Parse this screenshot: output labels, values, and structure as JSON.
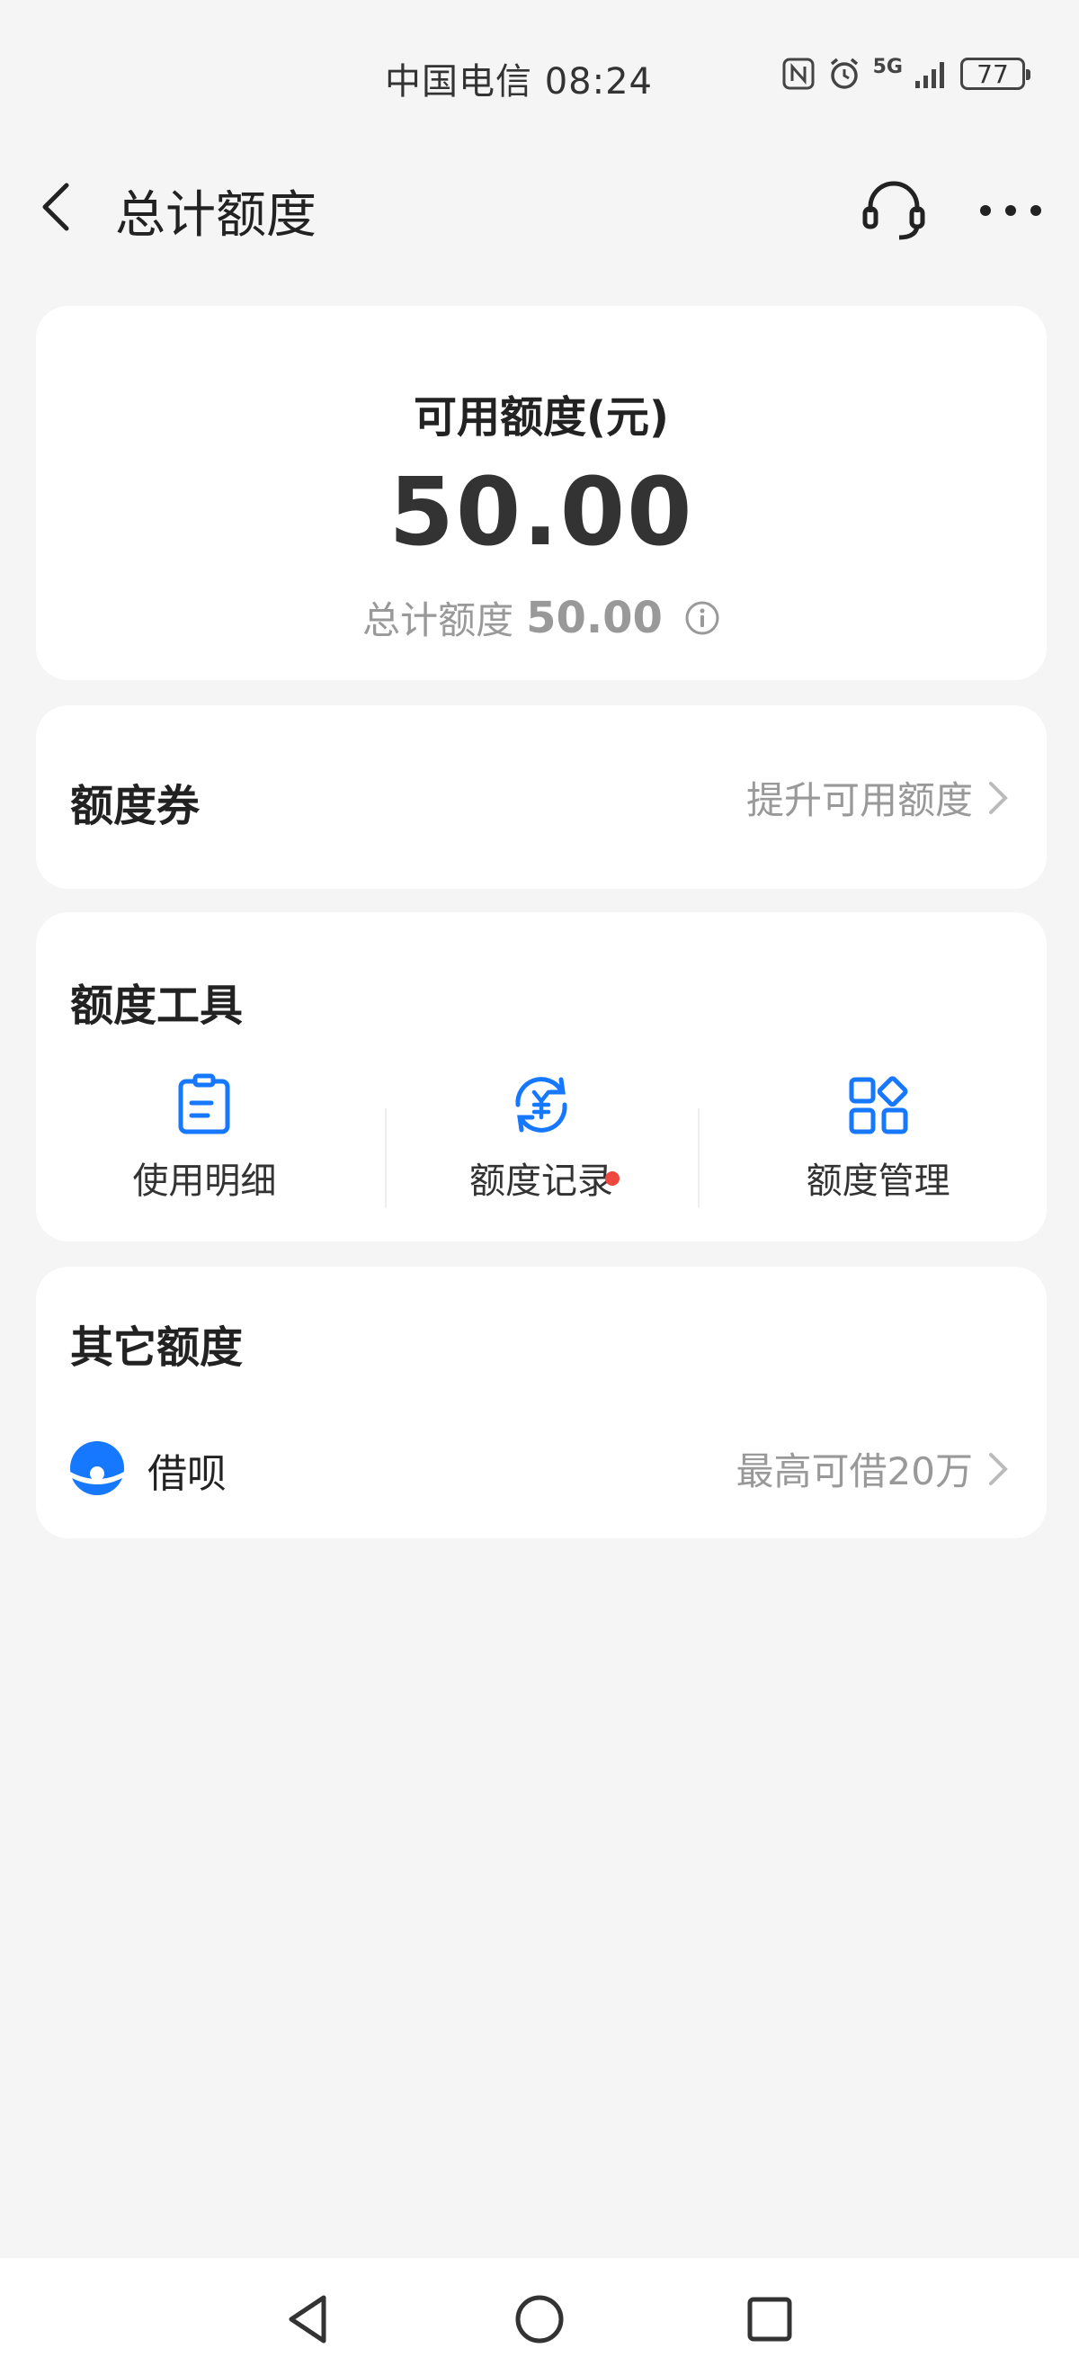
{
  "status_bar": {
    "carrier_time": "中国电信 08:24",
    "network": "5G",
    "battery": "77"
  },
  "header": {
    "title": "总计额度"
  },
  "quota_card": {
    "label": "可用额度(元)",
    "value": "50.00",
    "total_label": "总计额度",
    "total_value": "50.00"
  },
  "coupon_card": {
    "title": "额度券",
    "action": "提升可用额度"
  },
  "tools_card": {
    "title": "额度工具",
    "items": [
      {
        "label": "使用明细",
        "icon": "document-list-icon"
      },
      {
        "label": "额度记录",
        "icon": "yuan-refresh-icon",
        "badge": "red-dot"
      },
      {
        "label": "额度管理",
        "icon": "grid-manage-icon"
      }
    ]
  },
  "other_card": {
    "title": "其它额度",
    "item_label": "借呗",
    "item_action": "最高可借20万"
  },
  "colors": {
    "accent": "#1677ff",
    "badge": "#f0483e",
    "muted_text": "#999999"
  }
}
